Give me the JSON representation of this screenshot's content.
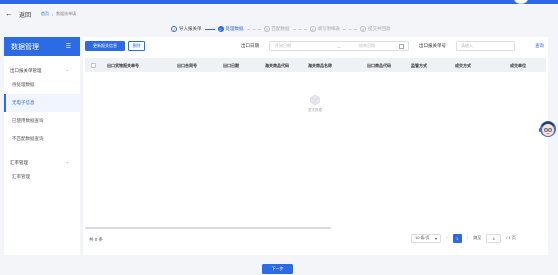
{
  "colors": {
    "primary": "#2d6be4",
    "background": "#f3f5f8"
  },
  "header": {
    "back_label": "返回",
    "breadcrumb": [
      "首页",
      "数据核单填"
    ]
  },
  "steps": [
    {
      "index": "1",
      "label": "导入报关单",
      "state": "done"
    },
    {
      "index": "2",
      "label": "处理数据",
      "state": "active"
    },
    {
      "index": "3",
      "label": "匹配数据",
      "state": "pending"
    },
    {
      "index": "4",
      "label": "填写明细表",
      "state": "pending"
    },
    {
      "index": "5",
      "label": "提交并回款",
      "state": "pending"
    }
  ],
  "sidebar": {
    "title": "数据管理",
    "groups": [
      {
        "label": "出口报关单管理",
        "items": [
          "待处理数据",
          "无电子信息",
          "已使用数据查询",
          "不匹配数据查询"
        ]
      },
      {
        "label": "汇率管理",
        "items": [
          "汇率管理"
        ]
      }
    ],
    "active_item": "无电子信息"
  },
  "toolbar": {
    "primary_button": "更新报关信息",
    "secondary_button": "删除",
    "date_label": "出口日期",
    "date_start_placeholder": "开始日期",
    "date_separator": "—",
    "date_end_placeholder": "结束日期",
    "customs_no_label": "出口报关单号",
    "customs_no_placeholder": "请输入",
    "query_button": "查询"
  },
  "table": {
    "columns": [
      "出口货物报关单号",
      "出口合同号",
      "出口日期",
      "海关商品代码",
      "海关商品名称",
      "出口商品代码",
      "监管方式",
      "成交方式",
      "成交单位"
    ],
    "rows": [],
    "empty_text": "暂无数据"
  },
  "footer": {
    "total_text": "共 0 条",
    "page_size": "10 条/页",
    "current_page": "1",
    "jump_label": "跳至",
    "jump_value": "1",
    "total_pages": "/ 1 页"
  },
  "next_button": "下一步"
}
